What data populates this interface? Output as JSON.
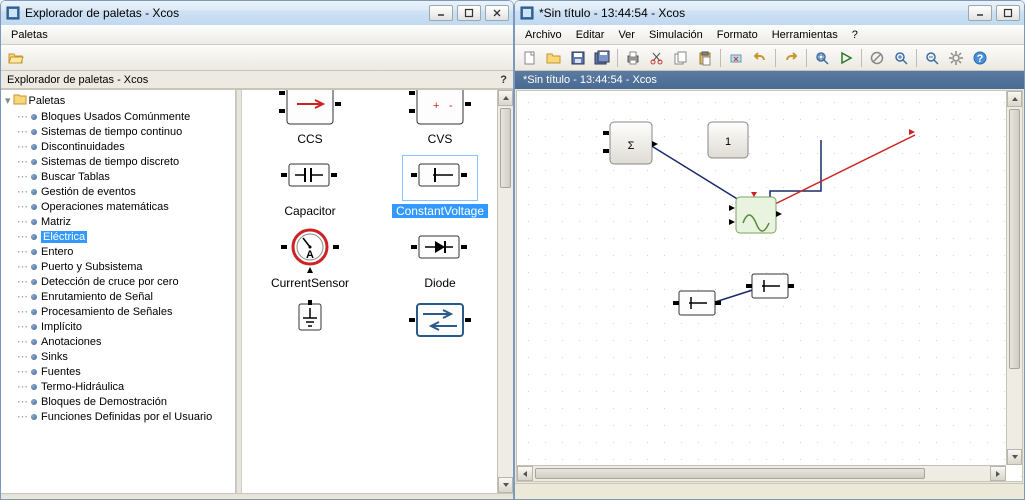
{
  "left_window": {
    "title": "Explorador de paletas - Xcos",
    "menubar": {
      "palettes": "Paletas"
    },
    "subtitle": "Explorador de paletas - Xcos",
    "help_symbol": "?",
    "tree_root": "Paletas",
    "selected_item": "Eléctrica",
    "items": [
      "Bloques Usados Comúnmente",
      "Sistemas de tiempo continuo",
      "Discontinuidades",
      "Sistemas de tiempo discreto",
      "Buscar Tablas",
      "Gestión de eventos",
      "Operaciones matemáticas",
      "Matriz",
      "Eléctrica",
      "Entero",
      "Puerto y Subsistema",
      "Detección de cruce por cero",
      "Enrutamiento de Señal",
      "Procesamiento de Señales",
      "Implícito",
      "Anotaciones",
      "Sinks",
      "Fuentes",
      "Termo-Hidráulica",
      "Bloques de Demostración",
      "Funciones Definidas por el Usuario"
    ],
    "blocks_selected": "ConstantVoltage",
    "blocks": [
      {
        "id": "ccs",
        "label": "CCS"
      },
      {
        "id": "cvs",
        "label": "CVS"
      },
      {
        "id": "capacitor",
        "label": "Capacitor"
      },
      {
        "id": "constv",
        "label": "ConstantVoltage"
      },
      {
        "id": "csensor",
        "label": "CurrentSensor"
      },
      {
        "id": "diode",
        "label": "Diode"
      },
      {
        "id": "ground",
        "label": ""
      },
      {
        "id": "switch",
        "label": ""
      }
    ]
  },
  "right_window": {
    "title": "*Sin título - 13:44:54 - Xcos",
    "menus": [
      "Archivo",
      "Editar",
      "Ver",
      "Simulación",
      "Formato",
      "Herramientas",
      "?"
    ],
    "toolbar_icons": [
      "new",
      "open",
      "save",
      "saveas",
      "print",
      "cut",
      "copy",
      "paste",
      "del",
      "undo",
      "redo",
      "fit",
      "play",
      "stop",
      "zoomin",
      "zoomout",
      "settings",
      "help"
    ],
    "tab_title": "*Sin título - 13:44:54 - Xcos",
    "canvas_blocks": {
      "sum": {
        "label": "Σ"
      },
      "const": {
        "label": "1"
      }
    }
  }
}
